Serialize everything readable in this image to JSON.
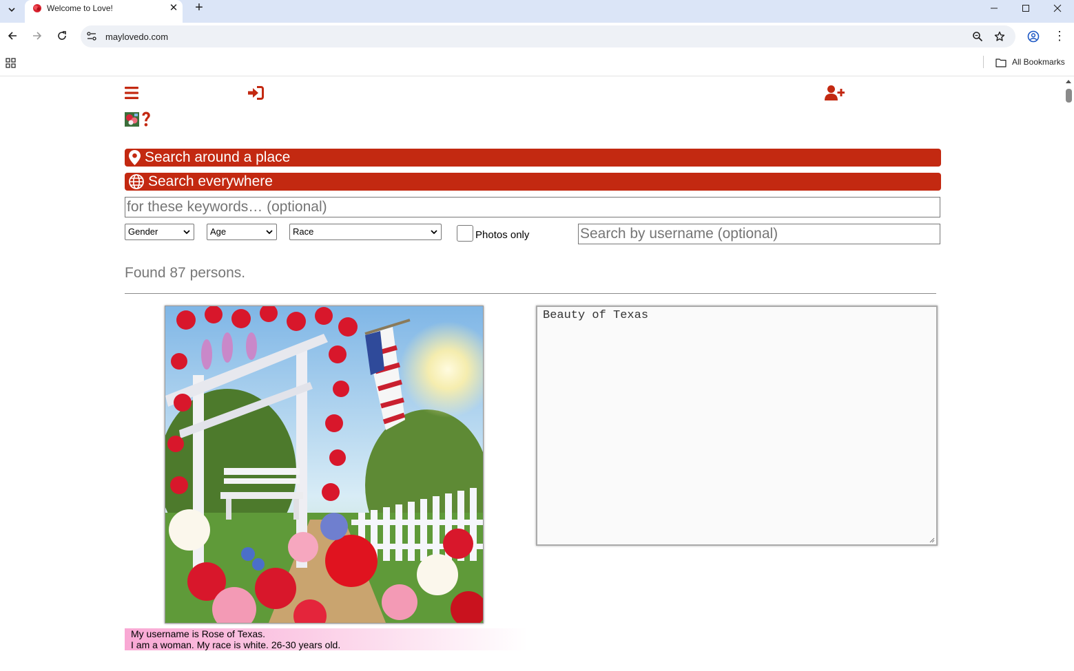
{
  "browser": {
    "tab_title": "Welcome to Love!",
    "url": "maylovedo.com",
    "bookmarks_label": "All Bookmarks"
  },
  "colors": {
    "brand_red": "#c32911",
    "chrome_blue": "#dbe5f7"
  },
  "page": {
    "search_place_label": "Search around a place",
    "search_everywhere_label": "Search everywhere",
    "keywords_placeholder": "for these keywords… (optional)",
    "gender_label": "Gender",
    "age_label": "Age",
    "race_label": "Race",
    "photos_only_label": "Photos only",
    "username_placeholder": "Search by username (optional)",
    "found_text": "Found 87 persons.",
    "profile": {
      "about": "Beauty of Texas",
      "line1": "My username is Rose of Texas.",
      "line2": "I am a woman. My race is white. 26-30 years old."
    }
  },
  "icons": [
    "menu-icon",
    "sign-in-icon",
    "add-user-icon",
    "help-icon",
    "map-marker-icon",
    "globe-icon"
  ]
}
